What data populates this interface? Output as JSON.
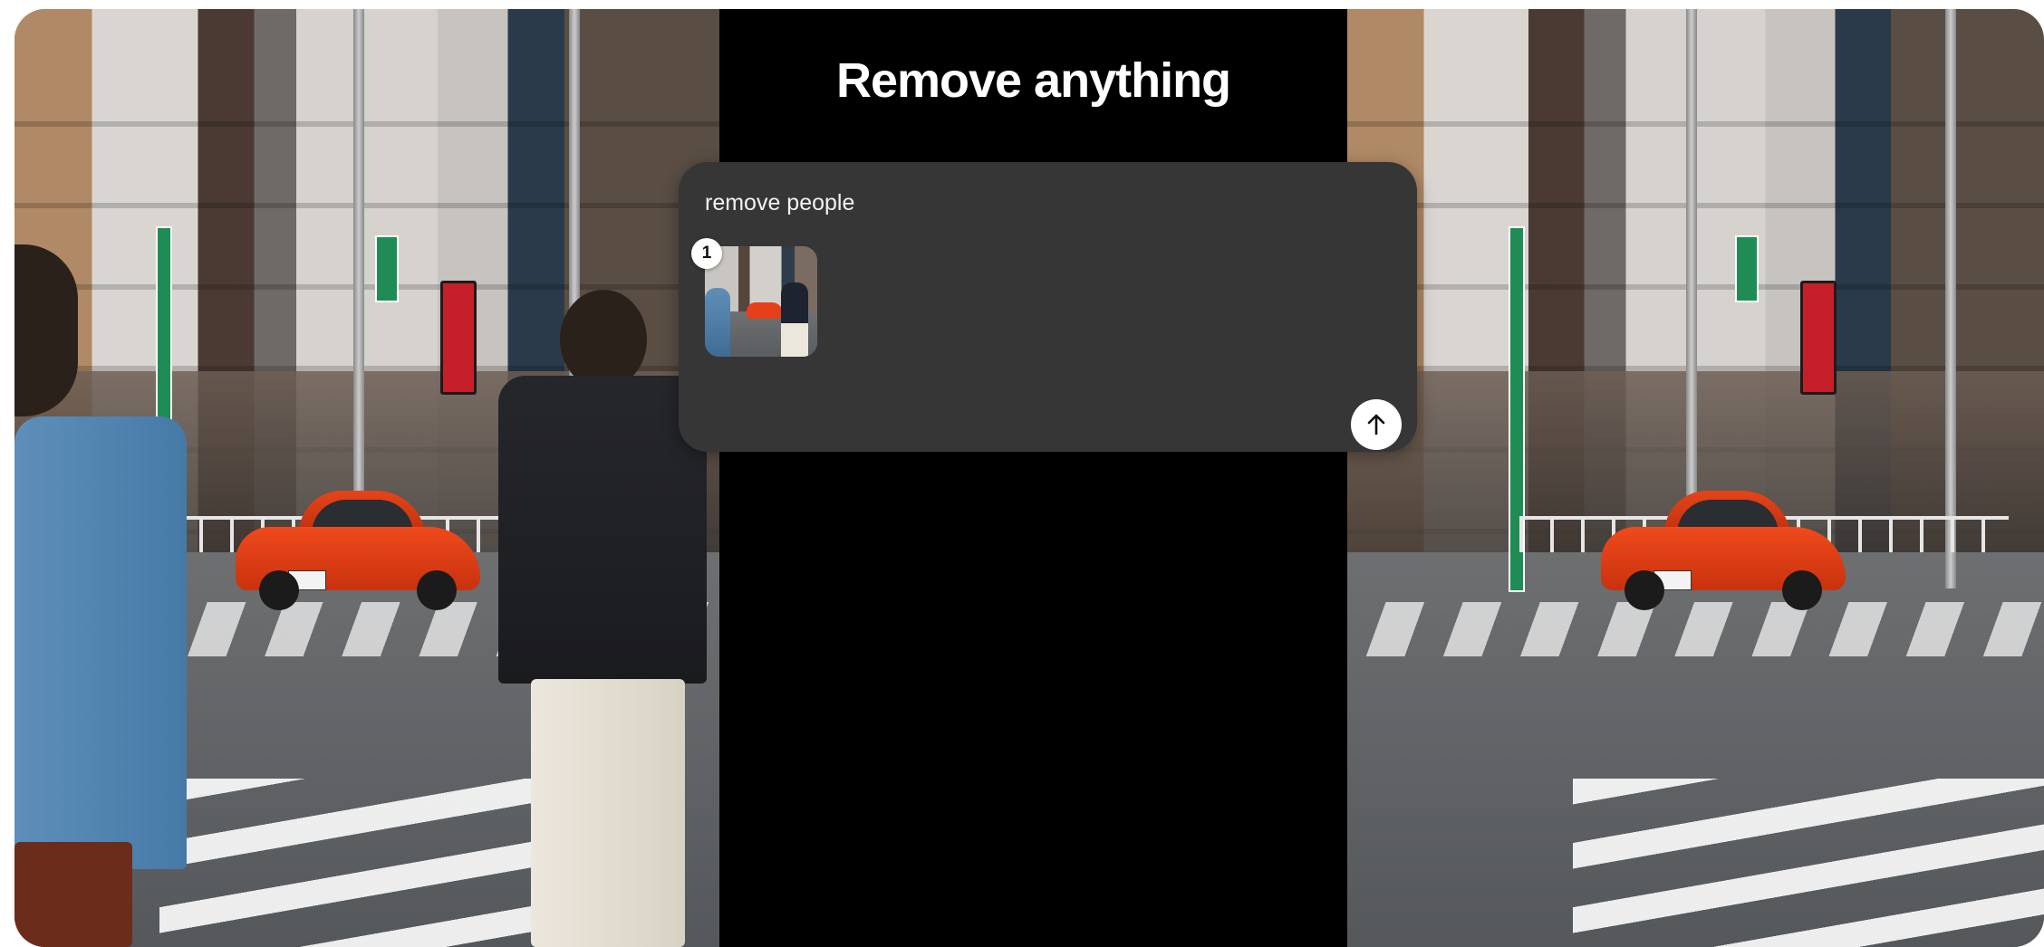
{
  "header": {
    "title": "Remove anything"
  },
  "composer": {
    "prompt_value": "remove people",
    "attachment": {
      "index_badge": "1",
      "icon": "image-thumbnail"
    },
    "send_button": {
      "icon": "arrow-up-icon"
    }
  },
  "panels": {
    "left": "original-video",
    "right": "result-video"
  },
  "colors": {
    "background": "#000000",
    "card": "#363636",
    "text": "#ffffff",
    "send_button": "#ffffff"
  }
}
